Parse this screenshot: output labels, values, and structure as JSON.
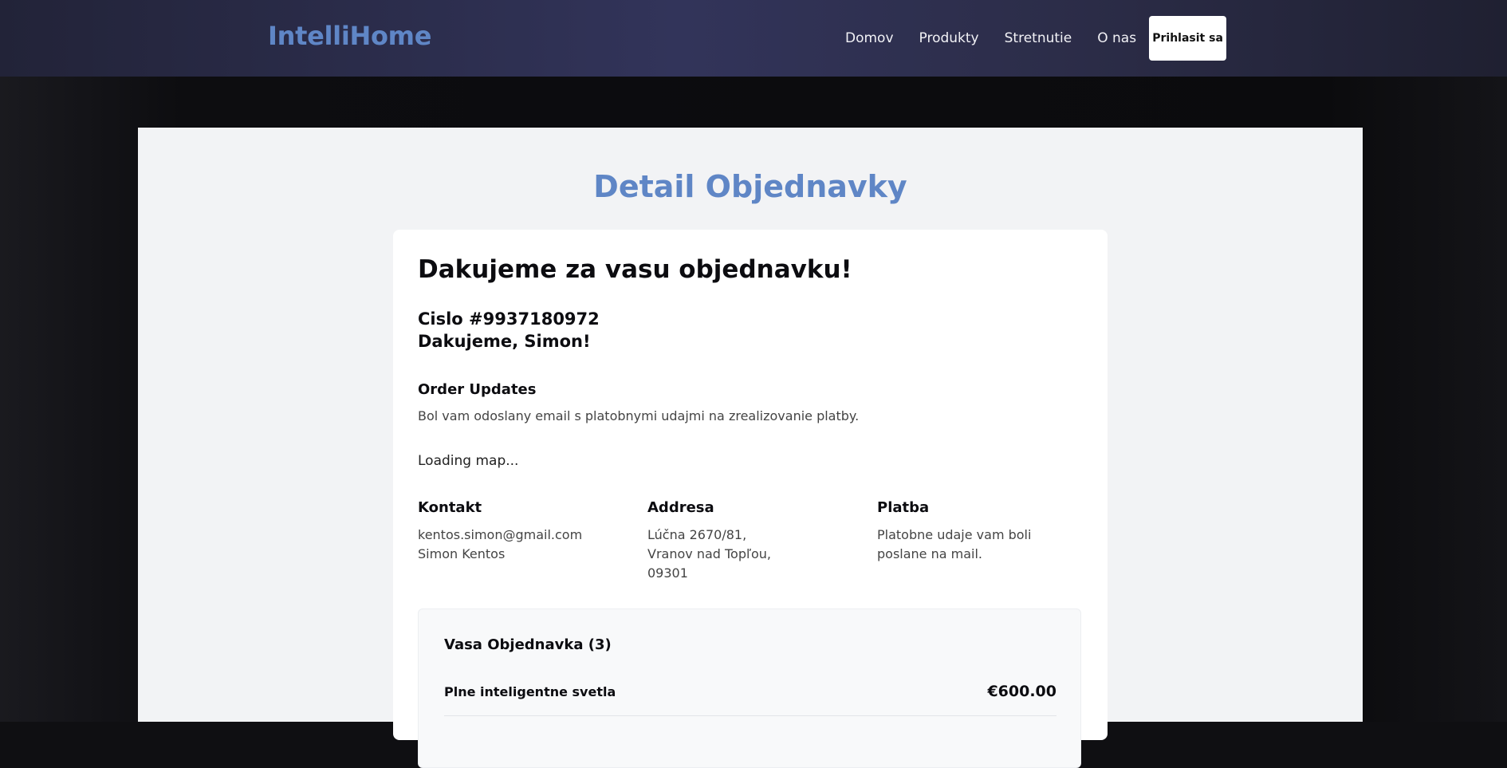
{
  "header": {
    "logo": "IntelliHome",
    "nav": [
      "Domov",
      "Produkty",
      "Stretnutie",
      "O nas"
    ],
    "login_label": "Prihlasit sa"
  },
  "page": {
    "title": "Detail Objednavky"
  },
  "order": {
    "thanks_heading": "Dakujeme za vasu objednavku!",
    "number": "Cislo #9937180972",
    "thanks_name": "Dakujeme, Simon!",
    "updates_title": "Order Updates",
    "updates_text": "Bol vam odoslany email s platobnymi udajmi na zrealizovanie platby.",
    "map_status": "Loading map...",
    "contact": {
      "title": "Kontakt",
      "email": "kentos.simon@gmail.com",
      "name": "Simon Kentos"
    },
    "address": {
      "title": "Addresa",
      "street": "Lúčna 2670/81,",
      "city": "Vranov nad Topľou,",
      "zip": "09301"
    },
    "payment": {
      "title": "Platba",
      "line1": "Platobne udaje vam boli",
      "line2": "poslane na mail."
    },
    "summary": {
      "title": "Vasa Objednavka (3)",
      "items": [
        {
          "name": "Plne inteligentne svetla",
          "price": "€600.00"
        }
      ]
    }
  }
}
